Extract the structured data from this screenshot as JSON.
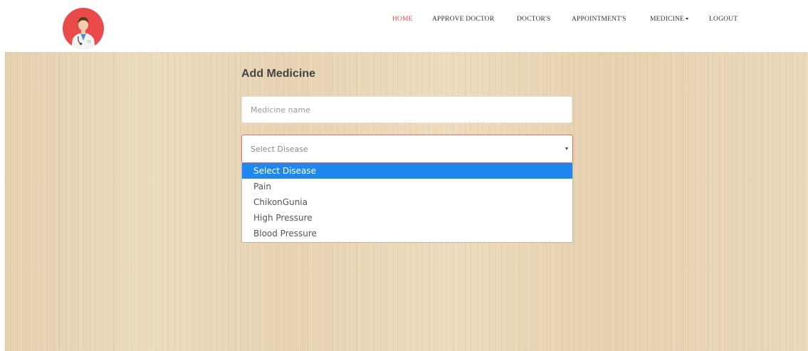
{
  "header": {
    "logo_icon": "doctor-avatar-icon",
    "nav": [
      {
        "label": "HOME",
        "active": true
      },
      {
        "label": "APPROVE DOCTOR",
        "active": false
      },
      {
        "label": "DOCTOR'S",
        "active": false
      },
      {
        "label": "APPOINTMENT'S",
        "active": false
      },
      {
        "label": "MEDICINE",
        "active": false,
        "has_dropdown": true
      },
      {
        "label": "LOGOUT",
        "active": false
      }
    ]
  },
  "form": {
    "title": "Add Medicine",
    "medicine_name": {
      "value": "",
      "placeholder": "Medicine name"
    },
    "disease_select": {
      "selected": "Select Disease",
      "options": [
        "Select Disease",
        "Pain",
        "ChikonGunia",
        "High Pressure",
        "Blood Pressure"
      ],
      "highlighted_index": 0
    }
  },
  "colors": {
    "accent": "#e24a4a",
    "logo_bg": "#ea4a4a",
    "highlight": "#1e88ee",
    "wood_bg": "#e8d5b5"
  }
}
